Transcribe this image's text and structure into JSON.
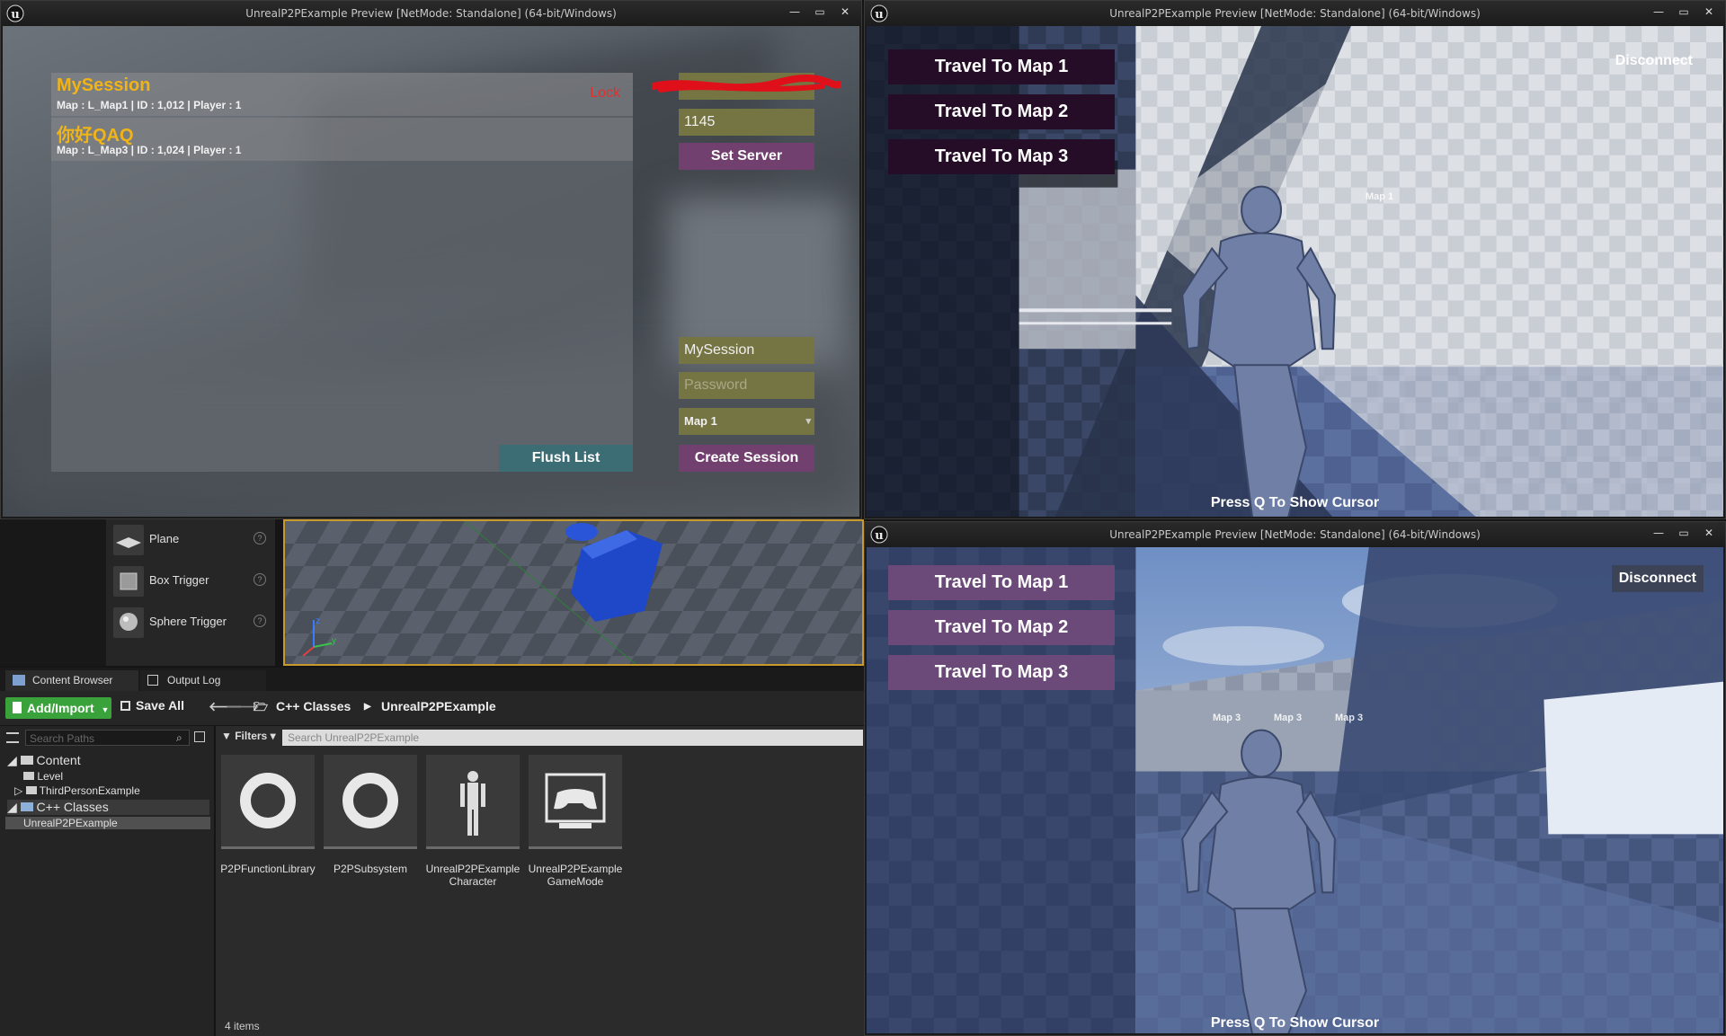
{
  "windows": {
    "title": "UnrealP2PExample Preview [NetMode: Standalone]  (64-bit/Windows)",
    "controls": {
      "minimize": "—",
      "maximize": "▭",
      "close": "✕"
    }
  },
  "session_ui": {
    "sessions": [
      {
        "name": "MySession",
        "info": "Map : L_Map1 | ID : 1,012 | Player : 1",
        "lock": "Lock"
      },
      {
        "name": "你好QAQ",
        "info": "Map : L_Map3 | ID : 1,024 | Player : 1",
        "lock": ""
      }
    ],
    "server_address_value": "",
    "port_value": "1145",
    "set_server_label": "Set Server",
    "session_name_value": "MySession",
    "password_placeholder": "Password",
    "map_select_value": "Map 1",
    "flush_list_label": "Flush List",
    "create_session_label": "Create Session"
  },
  "game_top": {
    "travel_buttons": [
      "Travel To Map 1",
      "Travel To Map 2",
      "Travel To Map 3"
    ],
    "disconnect_label": "Disconnect",
    "press_cursor_hint": "Press Q To Show Cursor",
    "map_labels": [
      "Map 1"
    ]
  },
  "game_bottom": {
    "travel_buttons": [
      "Travel To Map 1",
      "Travel To Map 2",
      "Travel To Map 3"
    ],
    "disconnect_label": "Disconnect",
    "press_cursor_hint": "Press Q To Show Cursor",
    "map_labels": [
      "Map 3",
      "Map 3",
      "Map 3"
    ]
  },
  "editor": {
    "place_modes": [
      "Plane",
      "Box Trigger",
      "Sphere Trigger"
    ],
    "help_glyph": "?",
    "tabs": [
      "Content Browser",
      "Output Log"
    ],
    "add_import_label": "Add/Import",
    "save_all_label": "Save All",
    "breadcrumbs": [
      "C++ Classes",
      "UnrealP2PExample"
    ],
    "search_paths_placeholder": "Search Paths",
    "tree": {
      "content": "Content",
      "level": "Level",
      "third_person": "ThirdPersonExample",
      "cpp_classes": "C++ Classes",
      "project": "UnrealP2PExample"
    },
    "filters_label": "Filters",
    "search_assets_placeholder": "Search UnrealP2PExample",
    "assets": [
      {
        "line1": "P2PFunctionLibrary",
        "line2": ""
      },
      {
        "line1": "P2PSubsystem",
        "line2": ""
      },
      {
        "line1": "UnrealP2PExample",
        "line2": "Character"
      },
      {
        "line1": "UnrealP2PExample",
        "line2": "GameMode"
      }
    ],
    "item_count": "4 items"
  },
  "colors": {
    "session_name": "#f0b418",
    "lock": "#e03030",
    "field_bg": "#757443",
    "button_purple": "#72406e",
    "flush_teal": "#3d6d74",
    "travel_bg": "#250c27",
    "add_import_green": "#3aa23a",
    "viewport_border": "#c89a2e"
  },
  "icons": {
    "logo": "unreal-u-logo",
    "tile_icons": [
      "function-library-ring-icon",
      "subsystem-ring-icon",
      "character-mannequin-icon",
      "gamemode-controller-icon"
    ]
  }
}
